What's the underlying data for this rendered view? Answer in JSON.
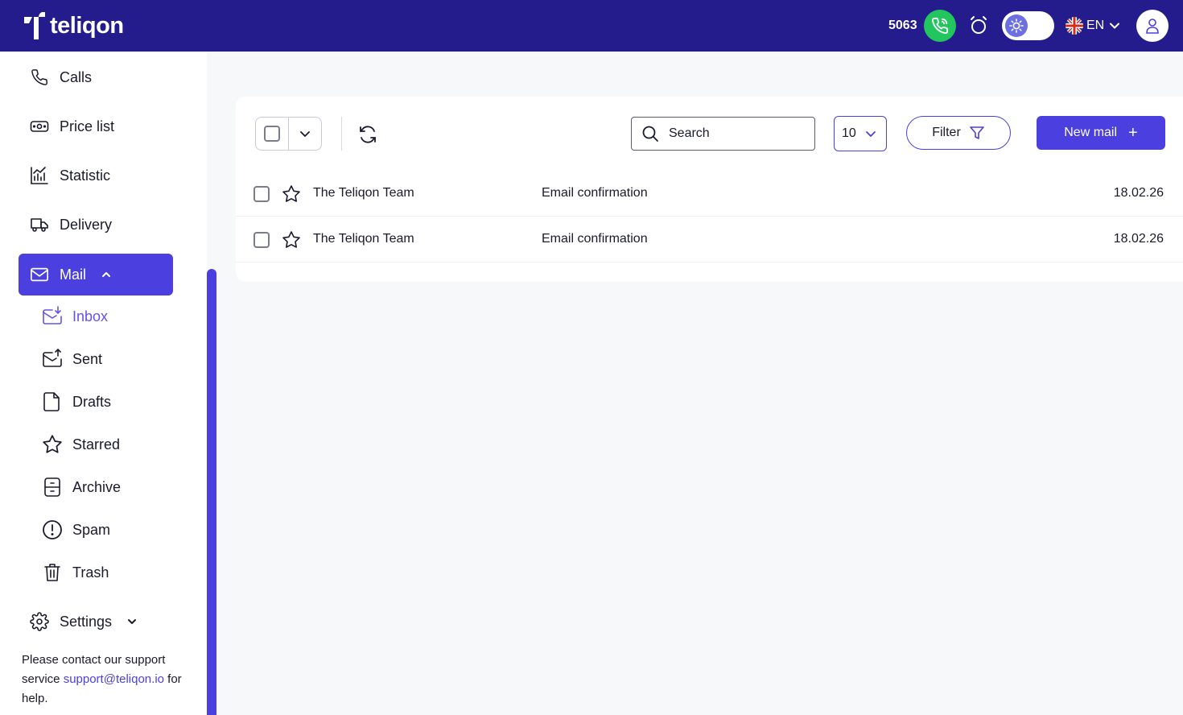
{
  "header": {
    "logo_text": "teliqon",
    "extension": "5063",
    "language": "EN"
  },
  "sidebar": {
    "items": [
      {
        "label": "Calls",
        "icon": "phone-icon"
      },
      {
        "label": "Price list",
        "icon": "price-tag-icon"
      },
      {
        "label": "Statistic",
        "icon": "chart-icon"
      },
      {
        "label": "Delivery",
        "icon": "truck-icon"
      },
      {
        "label": "Mail",
        "icon": "mail-icon",
        "active": true
      },
      {
        "label": "Settings",
        "icon": "gear-icon"
      }
    ],
    "mail_sub": [
      {
        "label": "Inbox",
        "icon": "inbox-icon",
        "active": true
      },
      {
        "label": "Sent",
        "icon": "sent-icon"
      },
      {
        "label": "Drafts",
        "icon": "draft-icon"
      },
      {
        "label": "Starred",
        "icon": "star-icon"
      },
      {
        "label": "Archive",
        "icon": "archive-icon"
      },
      {
        "label": "Spam",
        "icon": "spam-icon"
      },
      {
        "label": "Trash",
        "icon": "trash-icon"
      }
    ],
    "support": {
      "before": "Please contact our support service ",
      "email": "support@teliqon.io",
      "after": " for help."
    }
  },
  "toolbar": {
    "search_placeholder": "Search",
    "per_page": "10",
    "filter_label": "Filter",
    "new_mail_label": "New mail",
    "new_mail_plus": "+"
  },
  "messages": [
    {
      "sender": "The Teliqon Team",
      "subject": "Email confirmation",
      "date": "18.02.26"
    },
    {
      "sender": "The Teliqon Team",
      "subject": "Email confirmation",
      "date": "18.02.26"
    }
  ],
  "colors": {
    "header_bg": "#241c8c",
    "accent": "#4b3fe0",
    "call_green": "#22c55e"
  }
}
